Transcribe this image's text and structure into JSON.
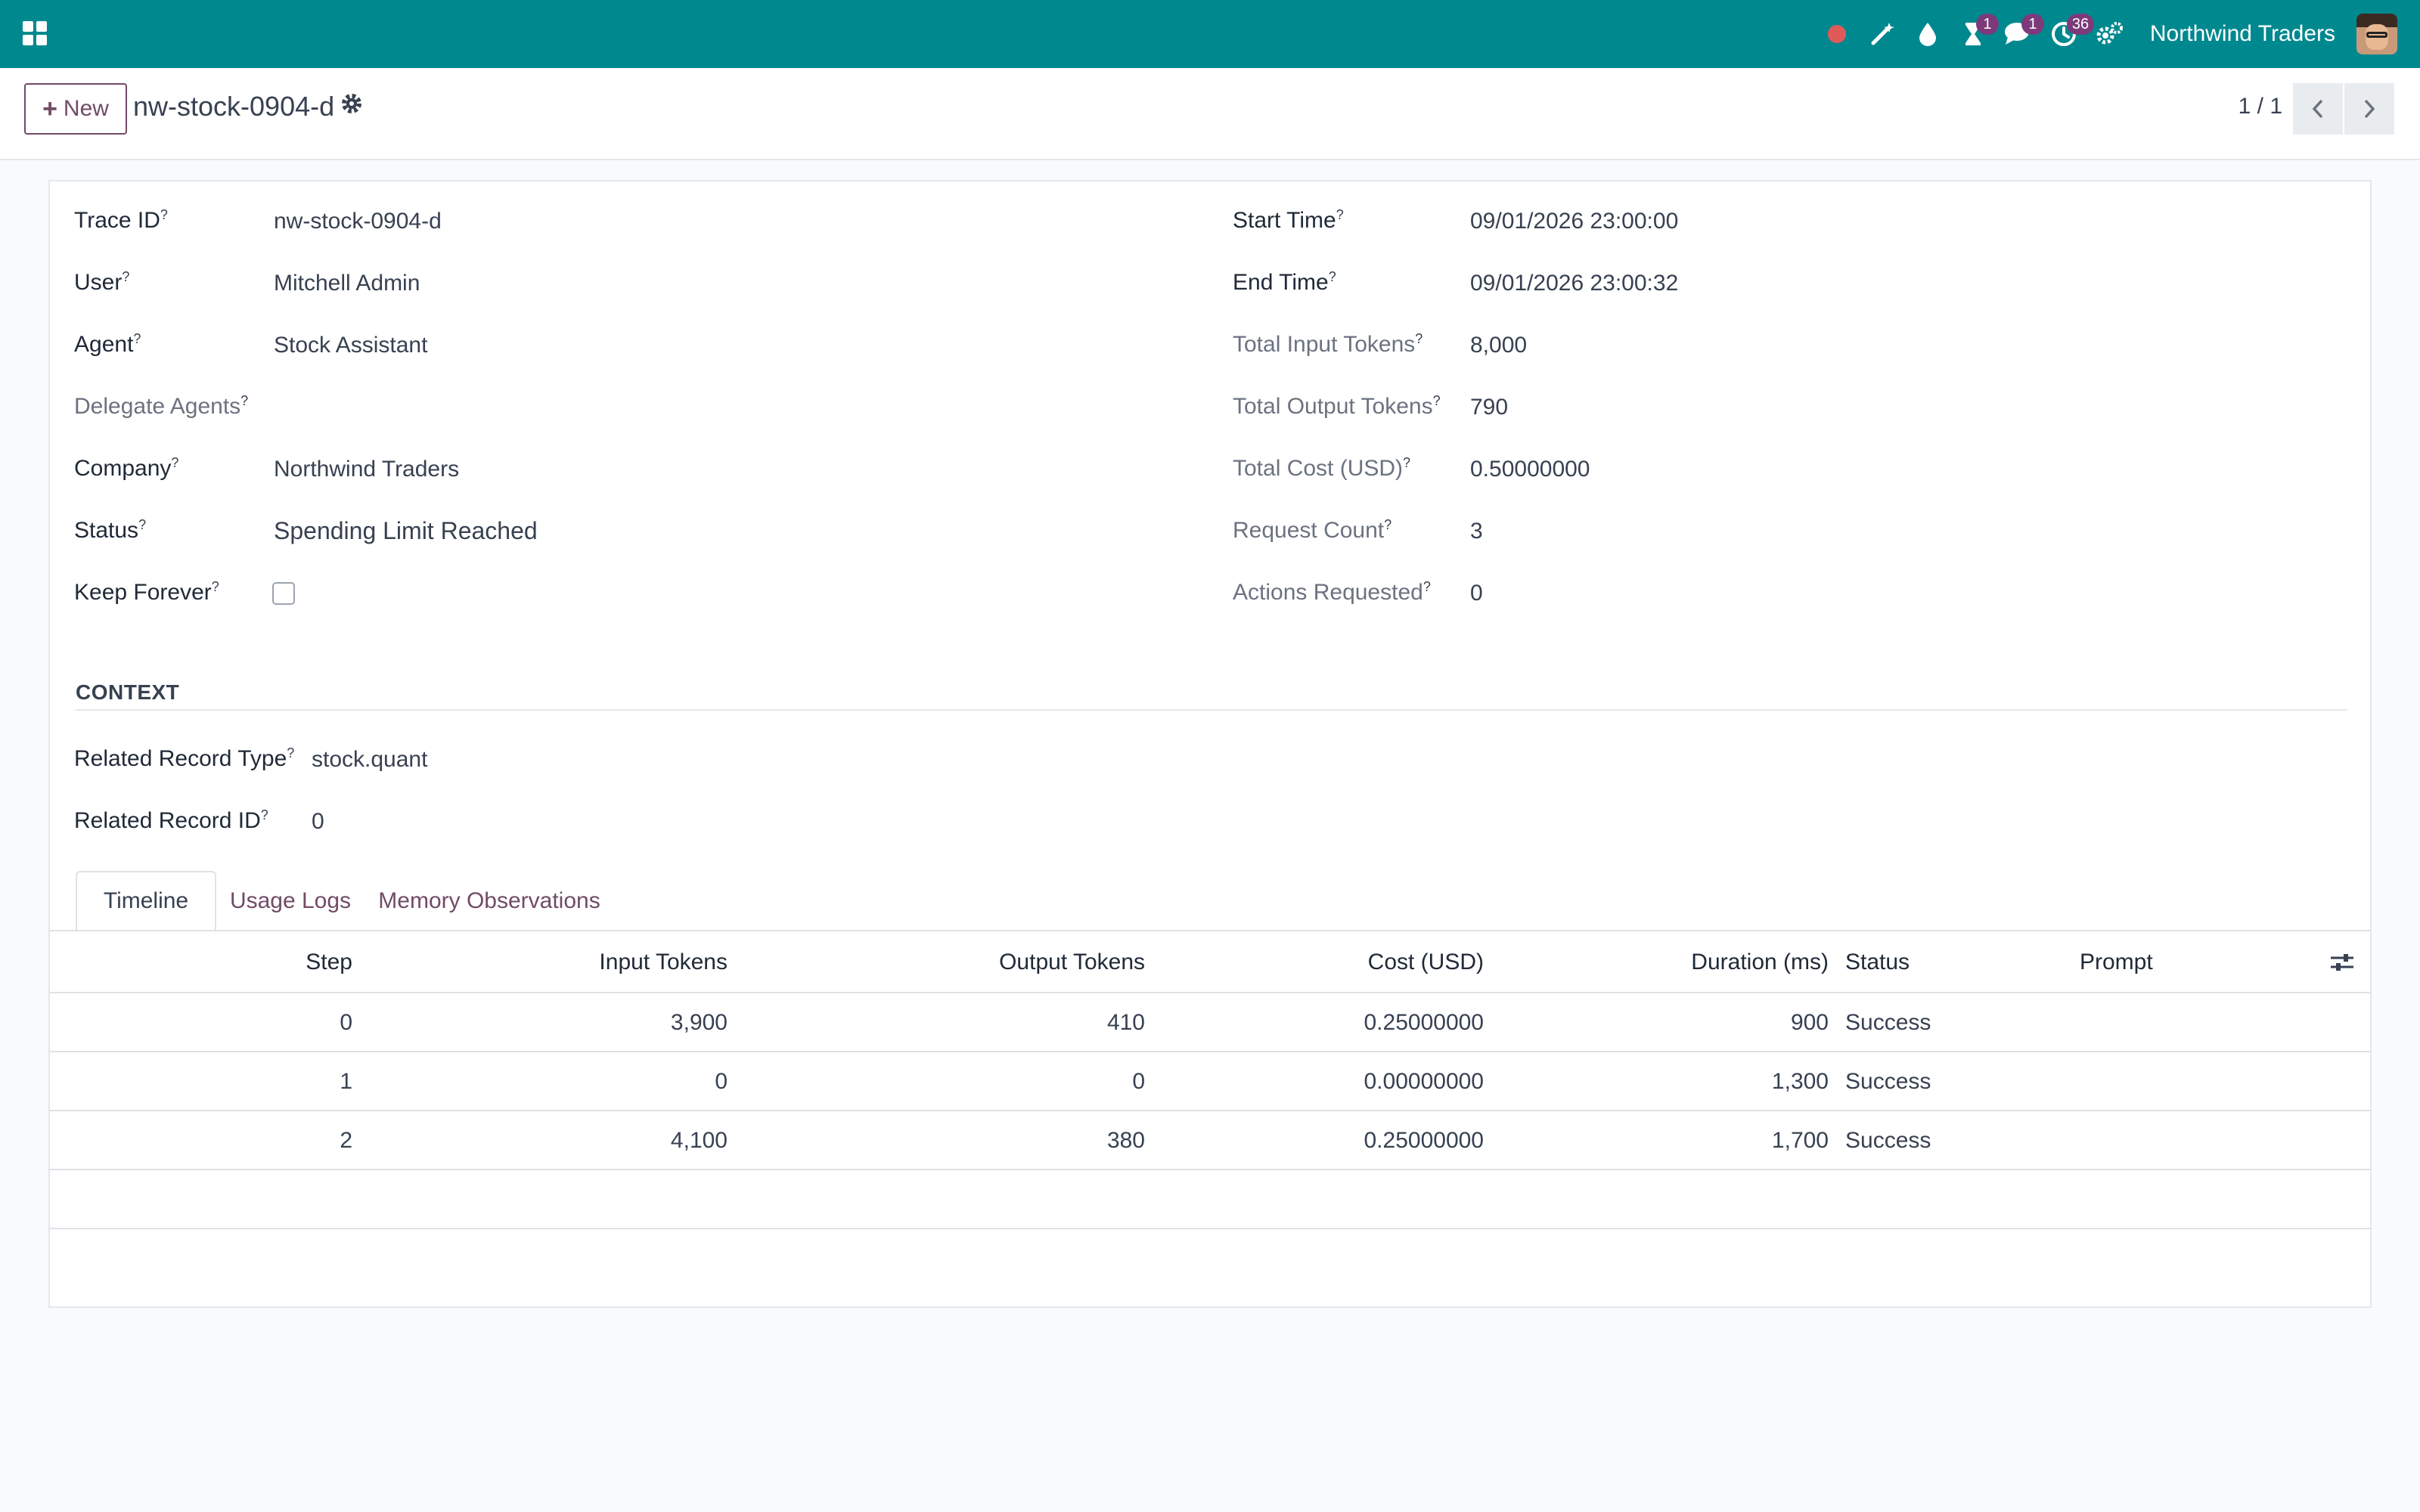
{
  "navbar": {
    "company": "Northwind Traders",
    "badges": {
      "activities": "1",
      "messages": "1",
      "timer": "36"
    },
    "accent_color": "#00888f",
    "badge_color": "#7c3a7a",
    "record_dot_color": "#e05a5a"
  },
  "control_bar": {
    "new_label": "New",
    "record_name": "nw-stock-0904-d",
    "pager": "1 / 1"
  },
  "form": {
    "left": [
      {
        "label": "Trace ID",
        "value": "nw-stock-0904-d"
      },
      {
        "label": "User",
        "value": "Mitchell Admin"
      },
      {
        "label": "Agent",
        "value": "Stock Assistant"
      },
      {
        "label": "Delegate Agents",
        "value": ""
      },
      {
        "label": "Company",
        "value": "Northwind Traders"
      },
      {
        "label": "Status",
        "value": "Spending Limit Reached"
      },
      {
        "label": "Keep Forever",
        "value": ""
      }
    ],
    "right": [
      {
        "label": "Start Time",
        "value": "09/01/2026 23:00:00"
      },
      {
        "label": "End Time",
        "value": "09/01/2026 23:00:32"
      },
      {
        "label": "Total Input Tokens",
        "value": "8,000"
      },
      {
        "label": "Total Output Tokens",
        "value": "790"
      },
      {
        "label": "Total Cost (USD)",
        "value": "0.50000000"
      },
      {
        "label": "Request Count",
        "value": "3"
      },
      {
        "label": "Actions Requested",
        "value": "0"
      }
    ],
    "keep_forever_checked": false
  },
  "context": {
    "title": "CONTEXT",
    "fields": [
      {
        "label": "Related Record Type",
        "value": "stock.quant"
      },
      {
        "label": "Related Record ID",
        "value": "0"
      }
    ]
  },
  "tabs": [
    "Timeline",
    "Usage Logs",
    "Memory Observations"
  ],
  "table": {
    "headers": [
      "Step",
      "Input Tokens",
      "Output Tokens",
      "Cost (USD)",
      "Duration (ms)",
      "Status",
      "Prompt"
    ],
    "rows": [
      [
        "0",
        "3,900",
        "410",
        "0.25000000",
        "900",
        "Success",
        ""
      ],
      [
        "1",
        "0",
        "0",
        "0.00000000",
        "1,300",
        "Success",
        ""
      ],
      [
        "2",
        "4,100",
        "380",
        "0.25000000",
        "1,700",
        "Success",
        ""
      ]
    ]
  }
}
